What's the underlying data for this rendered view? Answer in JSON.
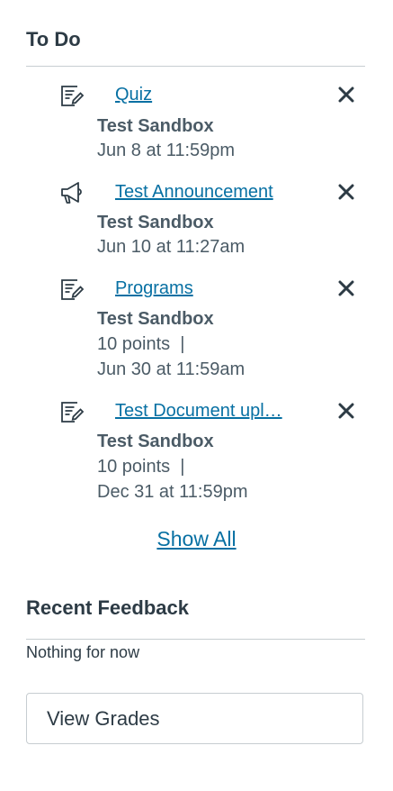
{
  "todo": {
    "title": "To Do",
    "items": [
      {
        "icon": "assignment-icon",
        "title": "Quiz",
        "course": "Test Sandbox",
        "points": "",
        "due": "Jun 8 at 11:59pm"
      },
      {
        "icon": "announcement-icon",
        "title": "Test Announcement",
        "course": "Test Sandbox",
        "points": "",
        "due": "Jun 10 at 11:27am"
      },
      {
        "icon": "assignment-icon",
        "title": "Programs",
        "course": "Test Sandbox",
        "points": "10 points  |",
        "due": "Jun 30 at 11:59am"
      },
      {
        "icon": "assignment-icon",
        "title": "Test Document upl…",
        "course": "Test Sandbox",
        "points": "10 points  |",
        "due": "Dec 31 at 11:59pm"
      }
    ],
    "show_all": "Show All"
  },
  "feedback": {
    "title": "Recent Feedback",
    "empty": "Nothing for now"
  },
  "view_grades": "View Grades",
  "colors": {
    "link": "#0770a3",
    "text": "#2d3b45",
    "border": "#c7cdd1"
  }
}
